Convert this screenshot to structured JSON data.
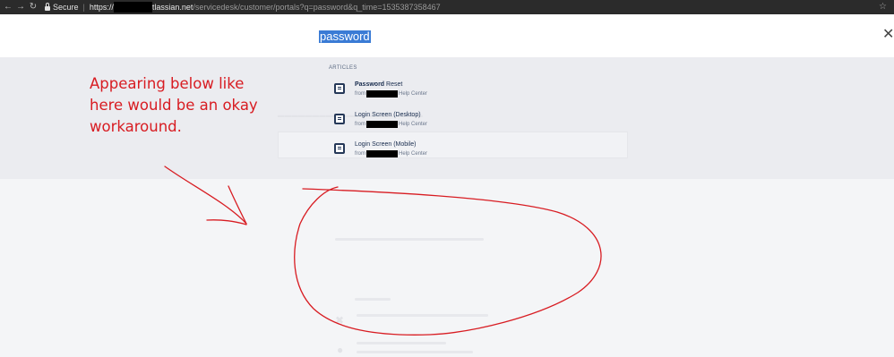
{
  "browser": {
    "back_icon": "arrow-left-icon",
    "forward_icon": "arrow-right-icon",
    "reload_icon": "reload-icon",
    "secure_label": "Secure",
    "url_scheme": "https://",
    "url_host_suffix": "tlassian.net",
    "url_path": "/servicedesk/customer/portals?q=password&q_time=1535387358467",
    "star_icon": "star-icon"
  },
  "search": {
    "query": "password",
    "close_icon": "close-icon"
  },
  "results": {
    "section_label": "ARTICLES",
    "articles": [
      {
        "title_bold": "Password",
        "title_rest": " Reset",
        "from_label": "from",
        "suffix": "Help Center"
      },
      {
        "title_bold": "",
        "title_rest": "Login Screen (Desktop)",
        "from_label": "from",
        "suffix": "Help Center"
      },
      {
        "title_bold": "",
        "title_rest": "Login Screen (Mobile)",
        "from_label": "from",
        "suffix": "Help Center"
      }
    ]
  },
  "annotation": {
    "text": "Appearing below like here would be an okay workaround.",
    "color": "#d81c22"
  },
  "colors": {
    "selection": "#3a7bd5",
    "band": "#ebecf0",
    "page": "#f4f5f7"
  }
}
